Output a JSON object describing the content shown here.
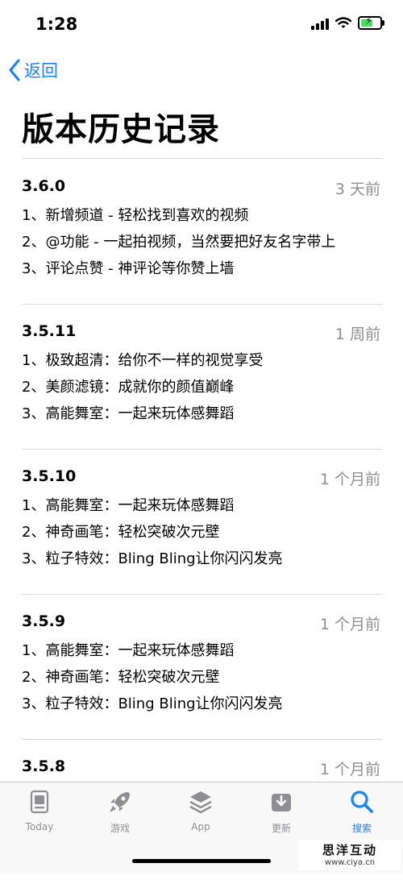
{
  "status_bar": {
    "time": "1:28"
  },
  "nav": {
    "back_label": "返回"
  },
  "page": {
    "title": "版本历史记录"
  },
  "history": [
    {
      "version": "3.6.0",
      "date": "3 天前",
      "notes": [
        "1、新增频道 - 轻松找到喜欢的视频",
        "2、@功能 - 一起拍视频，当然要把好友名字带上",
        "3、评论点赞 - 神评论等你赞上墙"
      ]
    },
    {
      "version": "3.5.11",
      "date": "1 周前",
      "notes": [
        "1、极致超清：给你不一样的视觉享受",
        "2、美颜滤镜：成就你的颜值巅峰",
        "3、高能舞室：一起来玩体感舞蹈"
      ]
    },
    {
      "version": "3.5.10",
      "date": "1 个月前",
      "notes": [
        "1、高能舞室：一起来玩体感舞蹈",
        "2、神奇画笔：轻松突破次元壁",
        "3、粒子特效：Bling Bling让你闪闪发亮"
      ]
    },
    {
      "version": "3.5.9",
      "date": "1 个月前",
      "notes": [
        "1、高能舞室：一起来玩体感舞蹈",
        "2、神奇画笔：轻松突破次元壁",
        "3、粒子特效：Bling Bling让你闪闪发亮"
      ]
    },
    {
      "version": "3.5.8",
      "date": "1 个月前",
      "notes": []
    }
  ],
  "tab_bar": {
    "tabs": [
      {
        "label": "Today",
        "icon": "today-icon",
        "active": false
      },
      {
        "label": "游戏",
        "icon": "rocket-icon",
        "active": false
      },
      {
        "label": "App",
        "icon": "app-stack-icon",
        "active": false
      },
      {
        "label": "更新",
        "icon": "download-tray-icon",
        "active": false
      },
      {
        "label": "搜索",
        "icon": "search-icon",
        "active": true
      }
    ]
  },
  "watermark": {
    "main": "思洋互动",
    "sub": "www.ciya.cn"
  },
  "colors": {
    "accent": "#1a82fb",
    "secondary_text": "#8e8e93",
    "battery_fill": "#4cd964"
  }
}
